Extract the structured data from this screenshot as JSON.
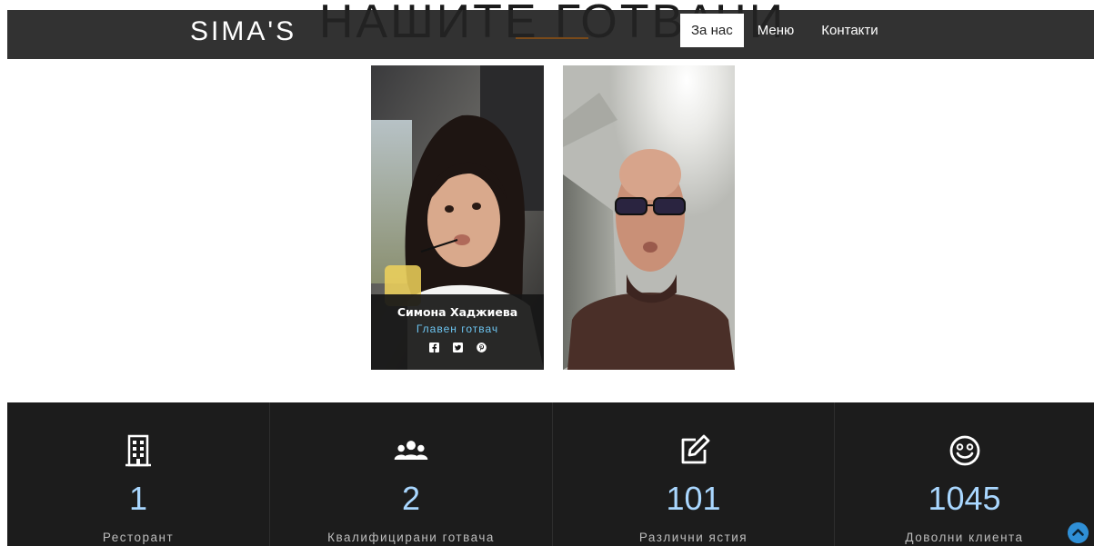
{
  "section": {
    "title": "НАШИТЕ ГОТВАЧИ"
  },
  "navbar": {
    "brand": "SIMA'S",
    "links": [
      {
        "label": "За нас",
        "active": true
      },
      {
        "label": "Меню",
        "active": false
      },
      {
        "label": "Контакти",
        "active": false
      }
    ]
  },
  "team": [
    {
      "name": "Симона Хаджиева",
      "role": "Главен готвач",
      "social": [
        "facebook-icon",
        "twitter-icon",
        "pinterest-icon"
      ]
    },
    {
      "name": "",
      "role": "",
      "social": []
    }
  ],
  "stats": [
    {
      "icon": "building-icon",
      "number": "1",
      "label": "Ресторант"
    },
    {
      "icon": "users-icon",
      "number": "2",
      "label": "Квалифицирани готвача"
    },
    {
      "icon": "edit-icon",
      "number": "101",
      "label": "Различни ястия"
    },
    {
      "icon": "smiley-icon",
      "number": "1045",
      "label": "Доволни клиента"
    }
  ],
  "colors": {
    "navbar_bg": "#222222",
    "stats_bg": "#1c1c1c",
    "stat_number": "#a9d7ff",
    "role_text": "#6cc4f0",
    "title_underline": "#7a4a1a",
    "back_to_top": "#2f8fd6"
  },
  "back_to_top": {
    "icon": "chevron-up-icon"
  }
}
